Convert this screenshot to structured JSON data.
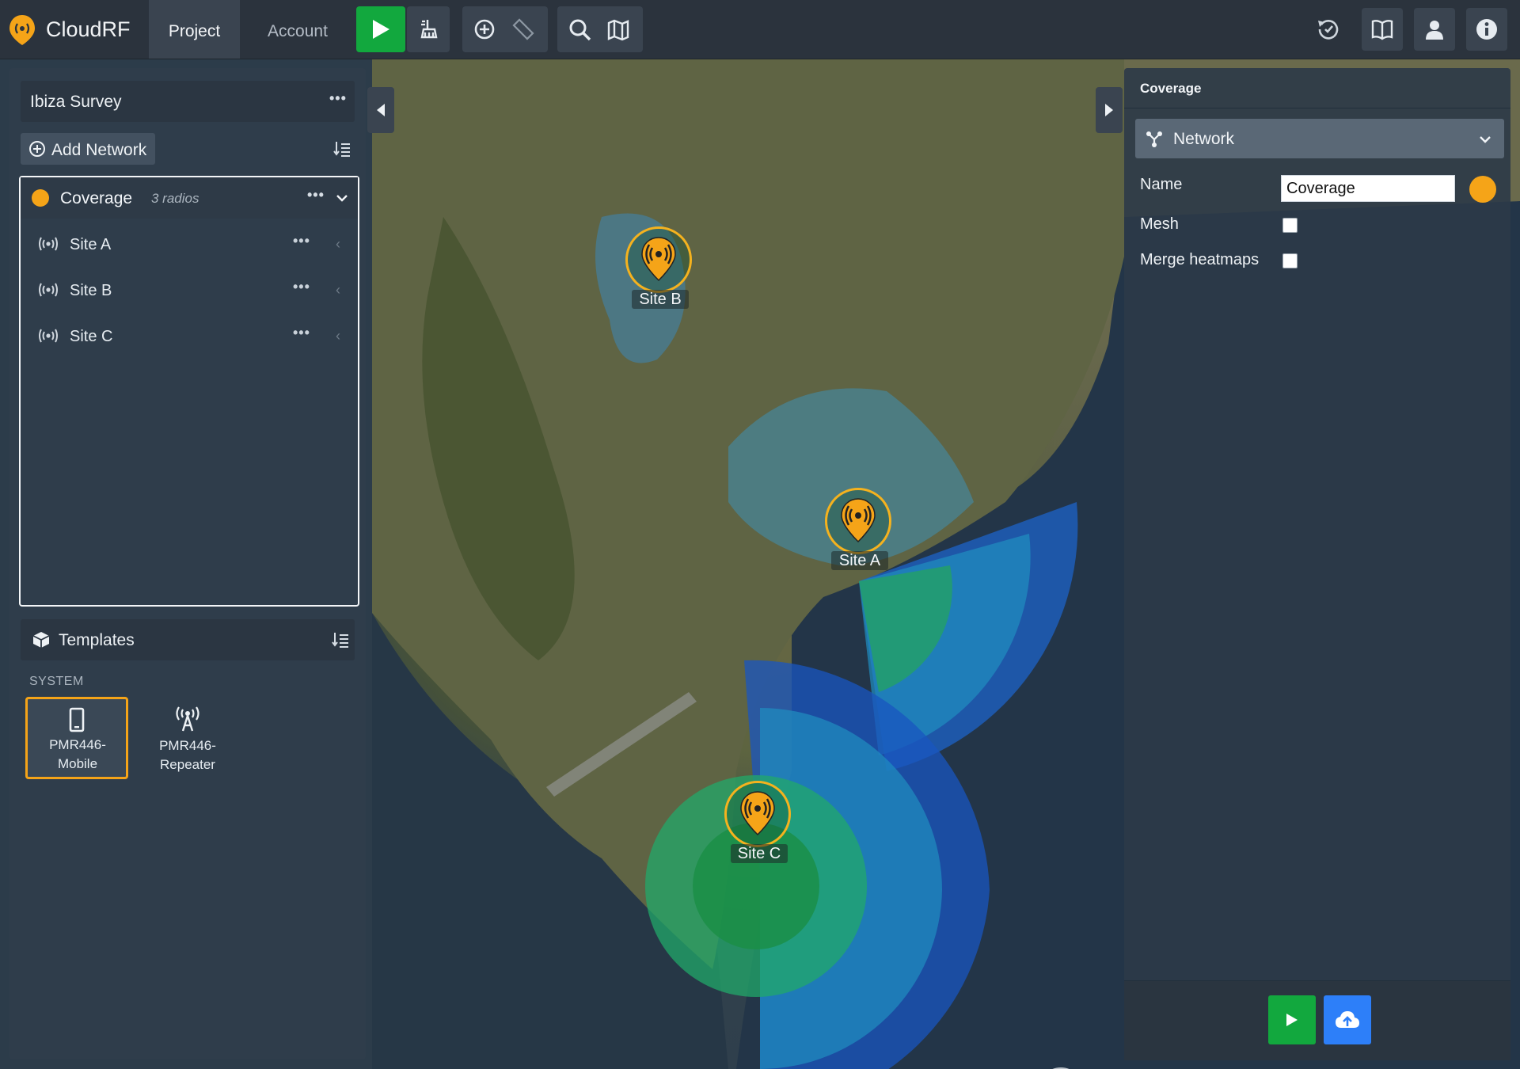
{
  "app": {
    "name": "CloudRF"
  },
  "nav": {
    "project": "Project",
    "account": "Account"
  },
  "project": {
    "title": "Ibiza Survey",
    "add_network": "Add Network",
    "network": {
      "name": "Coverage",
      "count": "3 radios",
      "color": "#f5a418",
      "radios": [
        {
          "label": "Site A"
        },
        {
          "label": "Site B"
        },
        {
          "label": "Site C"
        }
      ]
    },
    "templates": {
      "title": "Templates",
      "group": "SYSTEM",
      "items": [
        {
          "label": "PMR446-\nMobile",
          "line1": "PMR446-",
          "line2": "Mobile"
        },
        {
          "label": "PMR446-\nRepeater",
          "line1": "PMR446-",
          "line2": "Repeater"
        }
      ]
    }
  },
  "panel": {
    "title": "Coverage",
    "select_label": "Network",
    "name_label": "Name",
    "name_value": "Coverage",
    "mesh_label": "Mesh",
    "merge_label": "Merge heatmaps"
  },
  "map": {
    "sites": [
      {
        "label": "Site B"
      },
      {
        "label": "Site A"
      },
      {
        "label": "Site C"
      }
    ]
  },
  "colors": {
    "accent": "#f5a418",
    "run_green": "#12a83e",
    "upload_blue": "#2d7ff9"
  }
}
